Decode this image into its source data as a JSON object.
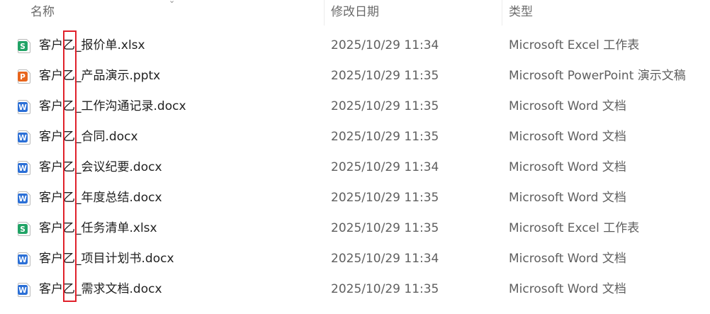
{
  "columns": {
    "name": "名称",
    "date": "修改日期",
    "type": "类型"
  },
  "files": [
    {
      "icon": "excel-file-icon",
      "prefix": "客户",
      "highlighted_char": "乙",
      "suffix": "_报价单.xlsx",
      "date": "2025/10/29 11:34",
      "type": "Microsoft Excel 工作表"
    },
    {
      "icon": "powerpoint-file-icon",
      "prefix": "客户",
      "highlighted_char": "乙",
      "suffix": "_产品演示.pptx",
      "date": "2025/10/29 11:35",
      "type": "Microsoft PowerPoint 演示文稿"
    },
    {
      "icon": "word-file-icon",
      "prefix": "客户",
      "highlighted_char": "乙",
      "suffix": "_工作沟通记录.docx",
      "date": "2025/10/29 11:35",
      "type": "Microsoft Word 文档"
    },
    {
      "icon": "word-file-icon",
      "prefix": "客户",
      "highlighted_char": "乙",
      "suffix": "_合同.docx",
      "date": "2025/10/29 11:35",
      "type": "Microsoft Word 文档"
    },
    {
      "icon": "word-file-icon",
      "prefix": "客户",
      "highlighted_char": "乙",
      "suffix": "_会议纪要.docx",
      "date": "2025/10/29 11:34",
      "type": "Microsoft Word 文档"
    },
    {
      "icon": "word-file-icon",
      "prefix": "客户",
      "highlighted_char": "乙",
      "suffix": "_年度总结.docx",
      "date": "2025/10/29 11:35",
      "type": "Microsoft Word 文档"
    },
    {
      "icon": "excel-file-icon",
      "prefix": "客户",
      "highlighted_char": "乙",
      "suffix": "_任务清单.xlsx",
      "date": "2025/10/29 11:35",
      "type": "Microsoft Excel 工作表"
    },
    {
      "icon": "word-file-icon",
      "prefix": "客户",
      "highlighted_char": "乙",
      "suffix": "_项目计划书.docx",
      "date": "2025/10/29 11:34",
      "type": "Microsoft Word 文档"
    },
    {
      "icon": "word-file-icon",
      "prefix": "客户",
      "highlighted_char": "乙",
      "suffix": "_需求文档.docx",
      "date": "2025/10/29 11:35",
      "type": "Microsoft Word 文档"
    }
  ],
  "colors": {
    "excel": "#21a366",
    "powerpoint": "#e8651d",
    "word": "#2b6fd6",
    "highlight_border": "#e0212b"
  },
  "icon_letters": {
    "excel": "S",
    "powerpoint": "P",
    "word": "W"
  }
}
